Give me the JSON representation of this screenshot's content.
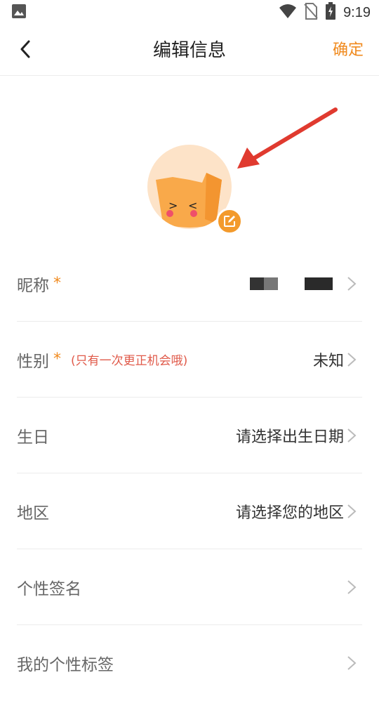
{
  "status_bar": {
    "time": "9:19",
    "icons": [
      "image-icon",
      "wifi-icon",
      "no-sim-icon",
      "battery-charging-icon"
    ]
  },
  "nav": {
    "back_icon": "chevron-left-icon",
    "title": "编辑信息",
    "confirm_label": "确定"
  },
  "avatar": {
    "edit_icon": "edit-icon",
    "annotation": "red-arrow-pointer"
  },
  "rows": [
    {
      "label": "昵称",
      "required": "*",
      "hint": "",
      "value": ""
    },
    {
      "label": "性别",
      "required": "*",
      "hint": "(只有一次更正机会哦)",
      "value": "未知"
    },
    {
      "label": "生日",
      "required": "",
      "hint": "",
      "value": "请选择出生日期"
    },
    {
      "label": "地区",
      "required": "",
      "hint": "",
      "value": "请选择您的地区"
    },
    {
      "label": "个性签名",
      "required": "",
      "hint": "",
      "value": ""
    },
    {
      "label": "我的个性标签",
      "required": "",
      "hint": "",
      "value": ""
    }
  ],
  "colors": {
    "accent": "#f08a1e",
    "hint_red": "#e05a4a",
    "avatar_bg": "#fde3c8"
  }
}
